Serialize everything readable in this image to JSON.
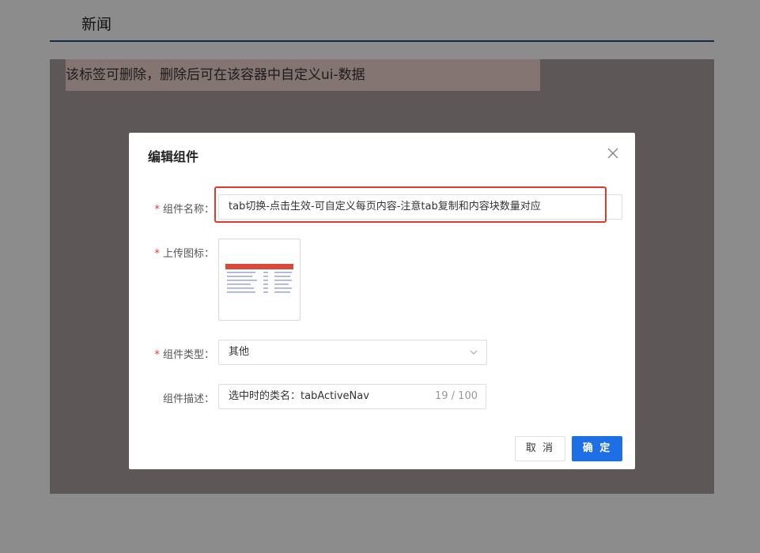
{
  "page": {
    "tab_title": "新闻",
    "content_note": "该标签可删除，删除后可在该容器中自定义ui-数据"
  },
  "dialog": {
    "title": "编辑组件",
    "fields": {
      "name": {
        "label": "组件名称：",
        "value": "tab切换-点击生效-可自定义每页内容-注意tab复制和内容块数量对应"
      },
      "icon": {
        "label": "上传图标："
      },
      "type": {
        "label": "组件类型：",
        "value": "其他"
      },
      "desc": {
        "label": "组件描述：",
        "value": "选中时的类名：tabActiveNav",
        "count": "19 / 100"
      }
    },
    "buttons": {
      "cancel": "取 消",
      "ok": "确 定"
    }
  },
  "colors": {
    "accent": "#1e6fe5",
    "highlight": "#e03a2d",
    "required": "#e53935"
  },
  "icons": [
    "close-icon",
    "chevron-down-icon"
  ]
}
